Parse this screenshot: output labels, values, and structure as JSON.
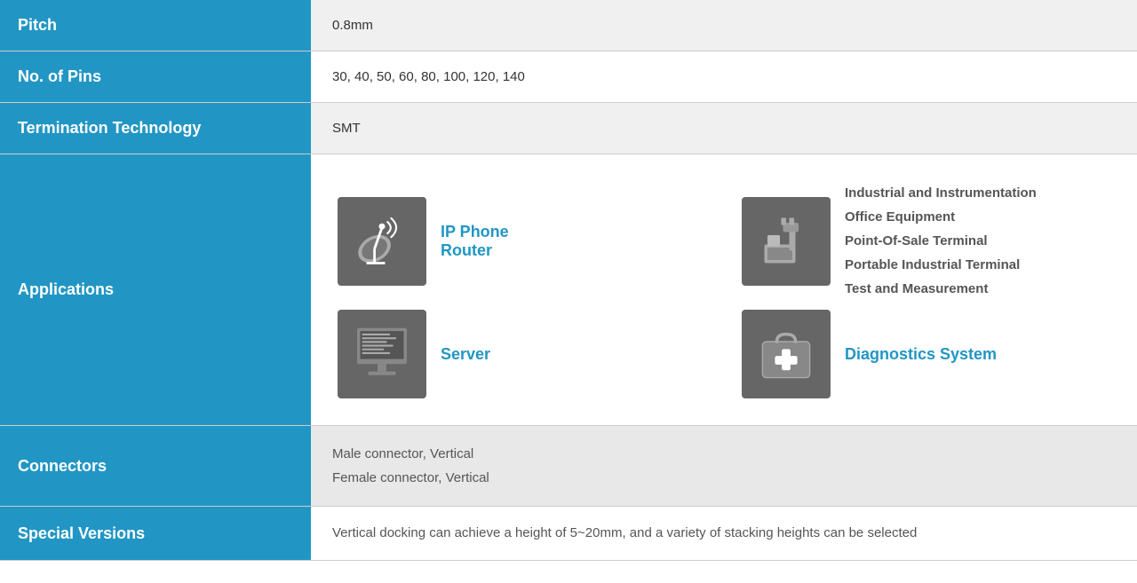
{
  "rows": {
    "pitch": {
      "label": "Pitch",
      "value": "0.8mm"
    },
    "no_of_pins": {
      "label": "No. of Pins",
      "value": "30, 40, 50, 60, 80, 100, 120, 140"
    },
    "termination_technology": {
      "label": "Termination Technology",
      "value": "SMT"
    },
    "applications": {
      "label": "Applications",
      "items": [
        {
          "id": "ip-phone-router",
          "label": "IP Phone\nRouter",
          "icon": "satellite"
        },
        {
          "id": "industrial",
          "label": "Industrial and Instrumentation\nOffice Equipment\nPoint-Of-Sale Terminal\nPortable Industrial Terminal\nTest and Measurement",
          "icon": "industrial"
        },
        {
          "id": "server",
          "label": "Server",
          "icon": "server"
        },
        {
          "id": "diagnostics",
          "label": "Diagnostics System",
          "icon": "diagnostics"
        }
      ]
    },
    "connectors": {
      "label": "Connectors",
      "line1": "Male connector, Vertical",
      "line2": "Female connector, Vertical"
    },
    "special_versions": {
      "label": "Special Versions",
      "value": "Vertical docking can achieve a height of 5~20mm, and a variety of stacking heights can be selected"
    }
  }
}
